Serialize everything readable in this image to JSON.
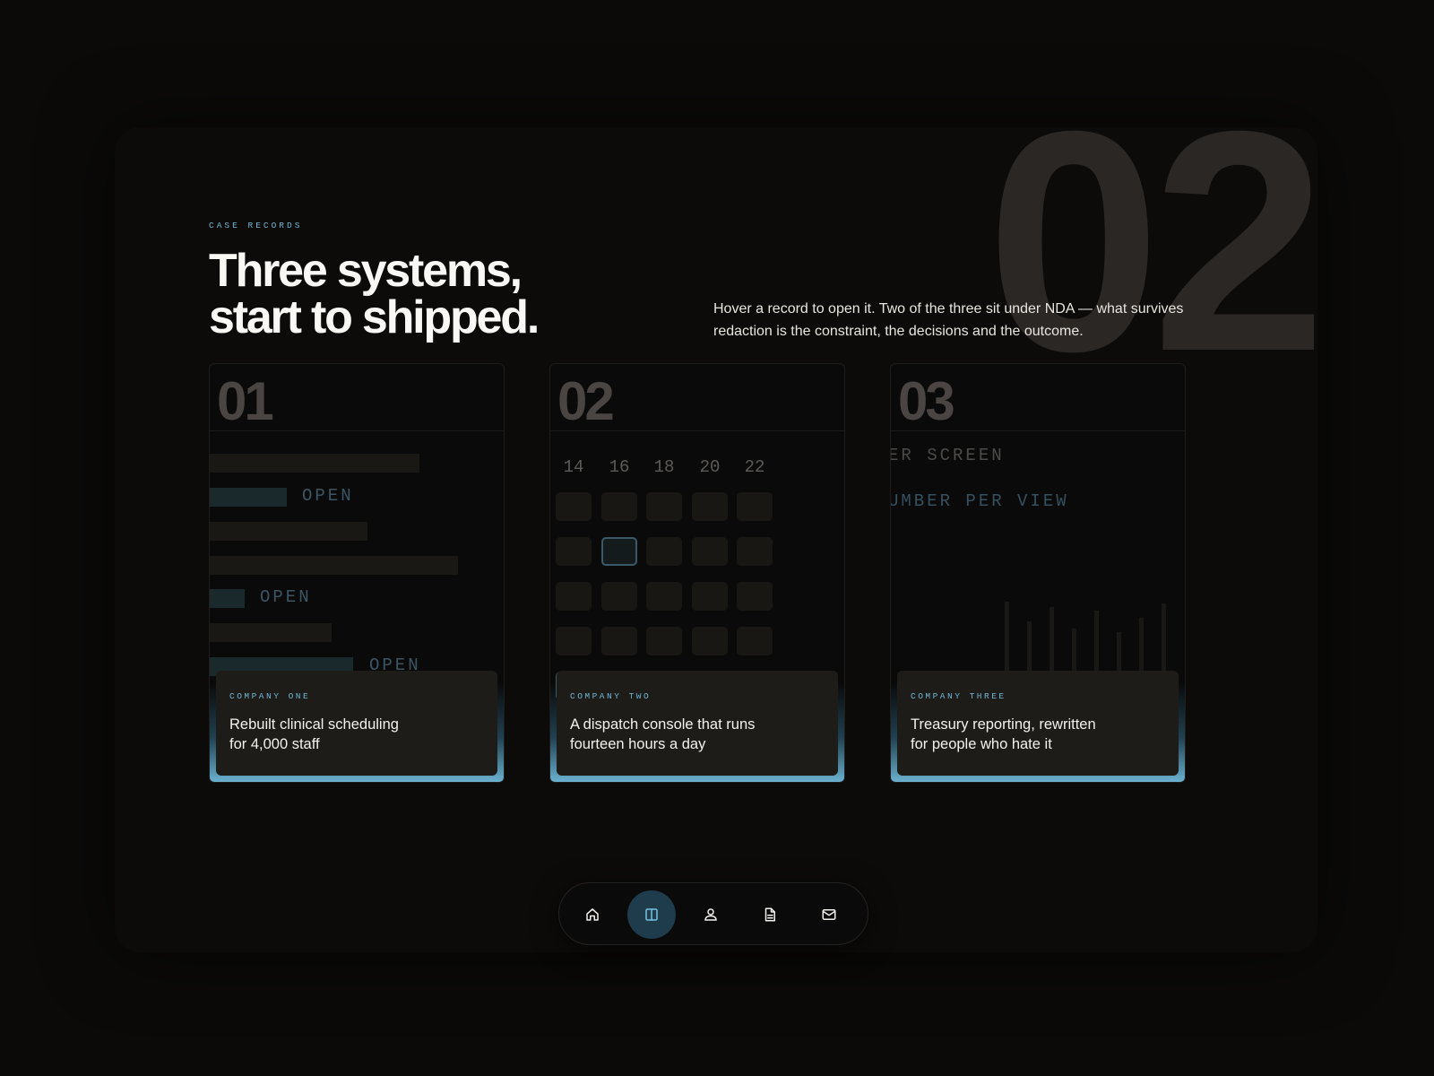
{
  "section": {
    "big_number": "02",
    "eyebrow": "CASE RECORDS",
    "headline": [
      "Three systems,",
      "start to shipped."
    ],
    "intro": "Hover a record to open it. Two of the three sit under NDA — what survives redaction is the constraint, the decisions and the outcome."
  },
  "cards": [
    {
      "number": "01",
      "company": "COMPANY ONE",
      "title": "Rebuilt clinical scheduling for 4,000 staff",
      "preview": {
        "status_label": "OPEN"
      }
    },
    {
      "number": "02",
      "company": "COMPANY TWO",
      "title": "A dispatch console that runs fourteen hours a day",
      "preview": {
        "days": [
          "14",
          "16",
          "18",
          "20",
          "22"
        ]
      }
    },
    {
      "number": "03",
      "company": "COMPANY THREE",
      "title": "Treasury reporting, rewritten for people who hate it",
      "preview": {
        "lines": [
          "ER SCREEN",
          "UMBER PER VIEW"
        ]
      }
    }
  ],
  "dock": {
    "items": [
      {
        "icon": "home-icon",
        "label": "Home",
        "active": false
      },
      {
        "icon": "layout-icon",
        "label": "Work",
        "active": true
      },
      {
        "icon": "user-icon",
        "label": "About",
        "active": false
      },
      {
        "icon": "document-icon",
        "label": "Resume",
        "active": false
      },
      {
        "icon": "mail-icon",
        "label": "Contact",
        "active": false
      }
    ]
  },
  "colors": {
    "accent": "#71b6d2",
    "background": "#0b0a09",
    "caption_bg": "#1d1c19",
    "dock_active": "#1e3c4b"
  }
}
